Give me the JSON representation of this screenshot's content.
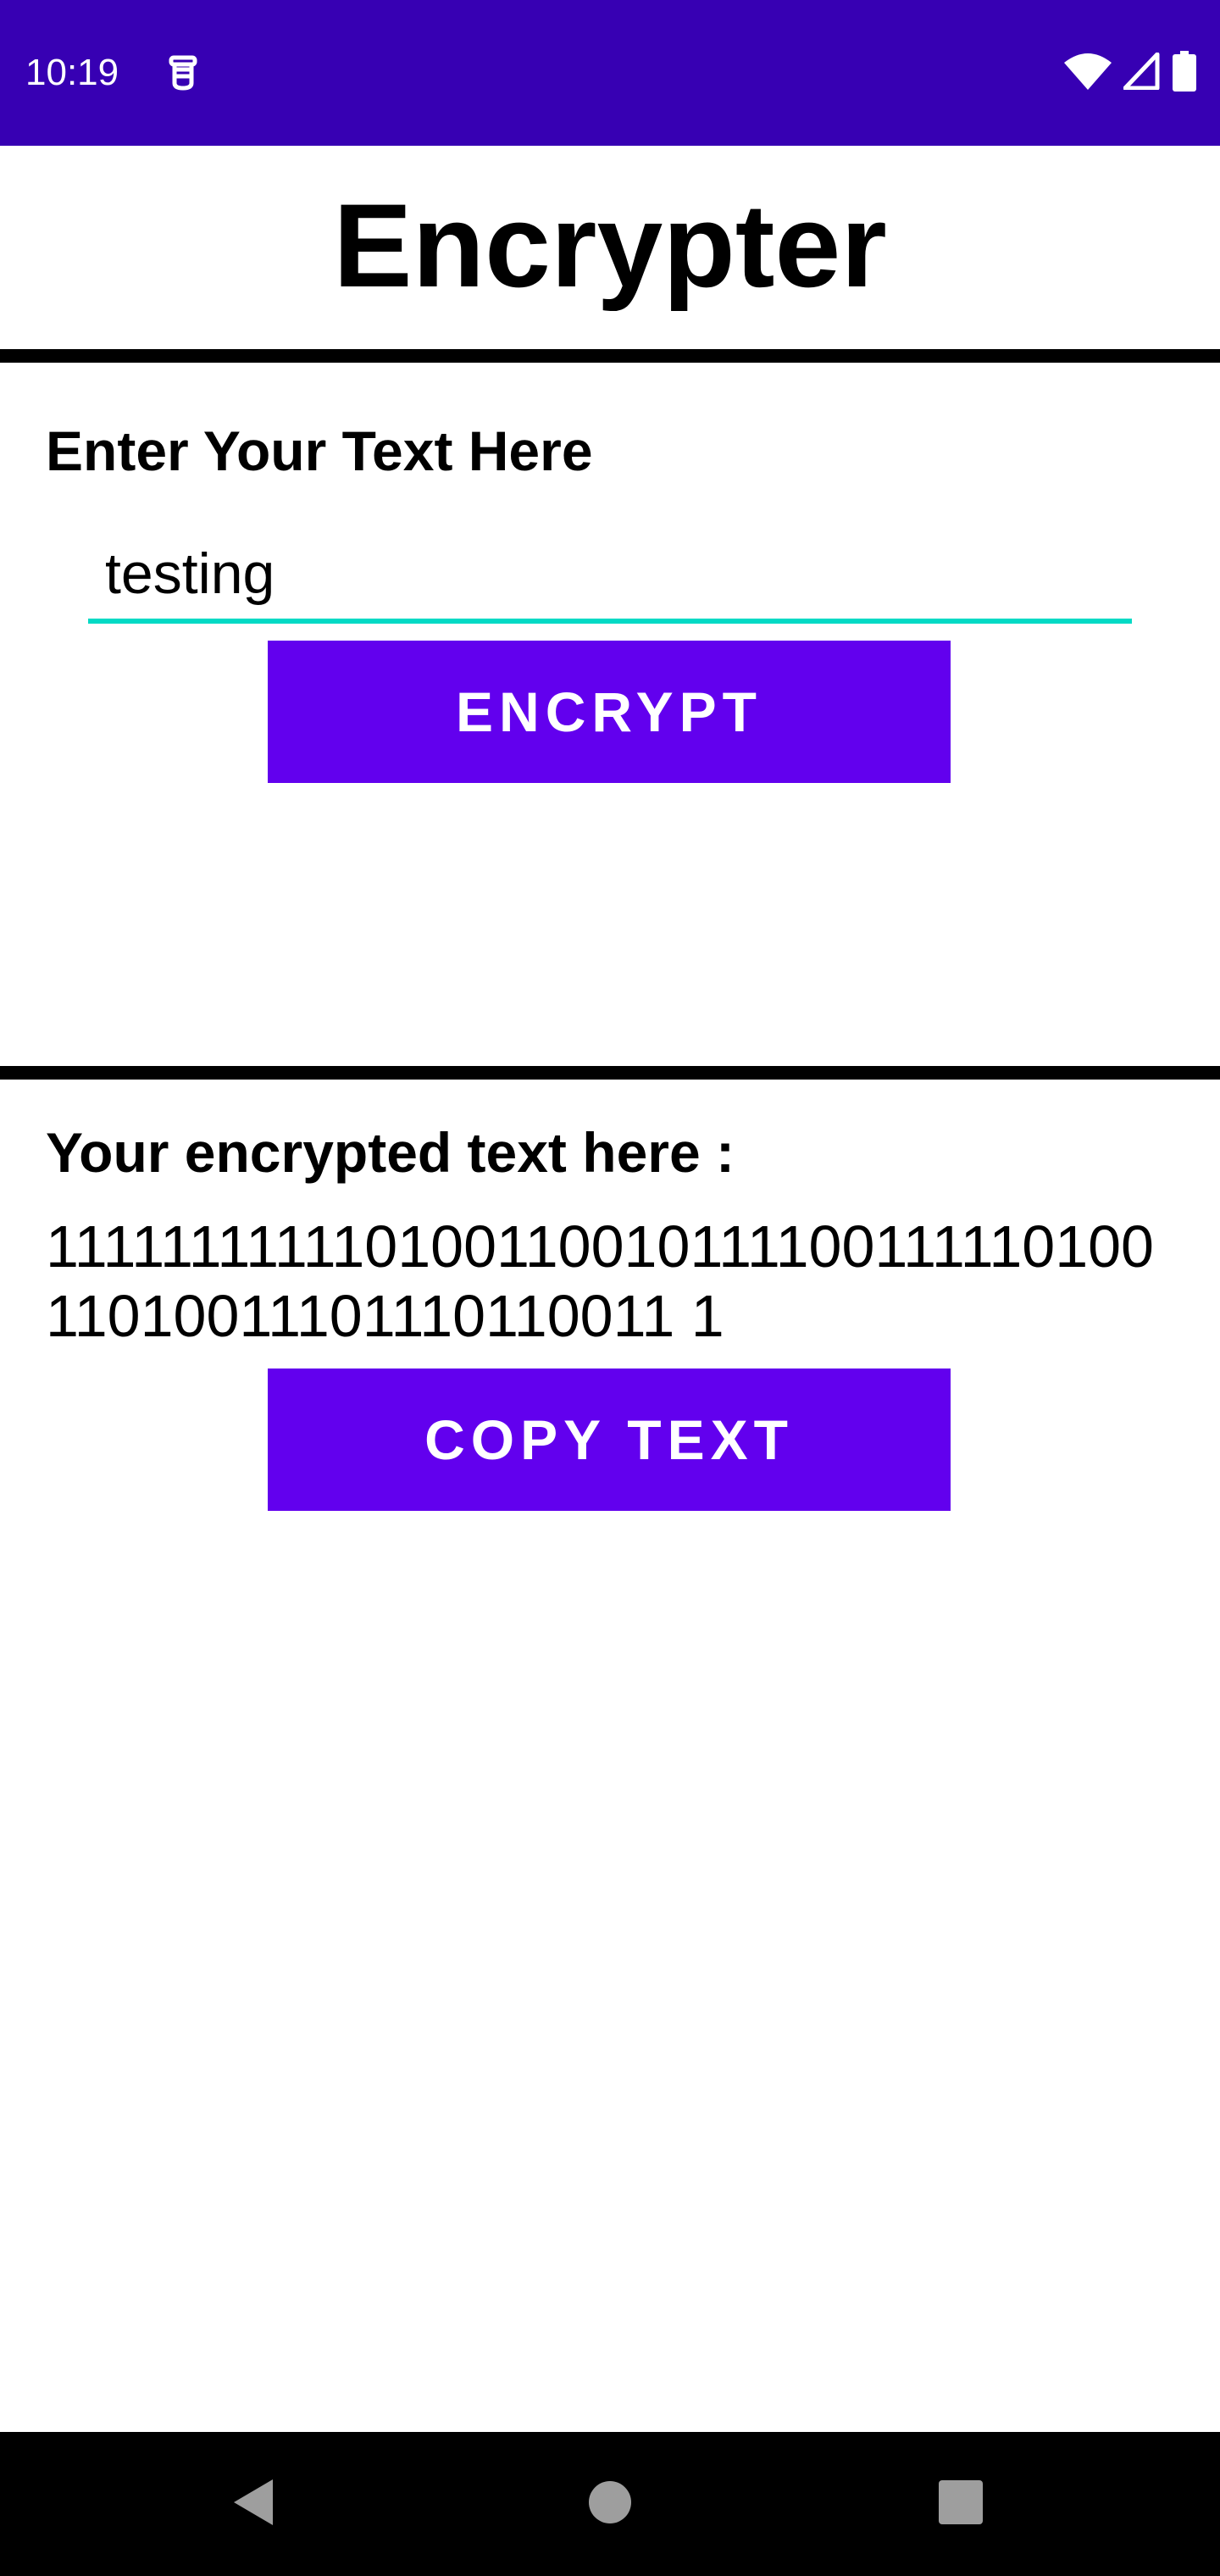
{
  "status_bar": {
    "time": "10:19",
    "app_icon": "app-notification-icon",
    "wifi_icon": "wifi-icon",
    "signal_icon": "cell-signal-icon",
    "battery_icon": "battery-icon",
    "background_color": "#3700b3"
  },
  "app": {
    "title": "Encrypter"
  },
  "input_section": {
    "label": "Enter Your Text Here",
    "input_value": "testing",
    "encrypt_button_label": "ENCRYPT"
  },
  "output_section": {
    "label": "Your encrypted text here :",
    "encrypted_text": "11111111111010011001011110011111010011010011101110110011 1",
    "copy_button_label": "COPY TEXT"
  },
  "nav_bar": {
    "back_icon": "back-triangle-icon",
    "home_icon": "home-circle-icon",
    "recents_icon": "recents-square-icon"
  },
  "colors": {
    "primary": "#6200ee",
    "primary_dark": "#3700b3",
    "accent": "#03dac5"
  }
}
